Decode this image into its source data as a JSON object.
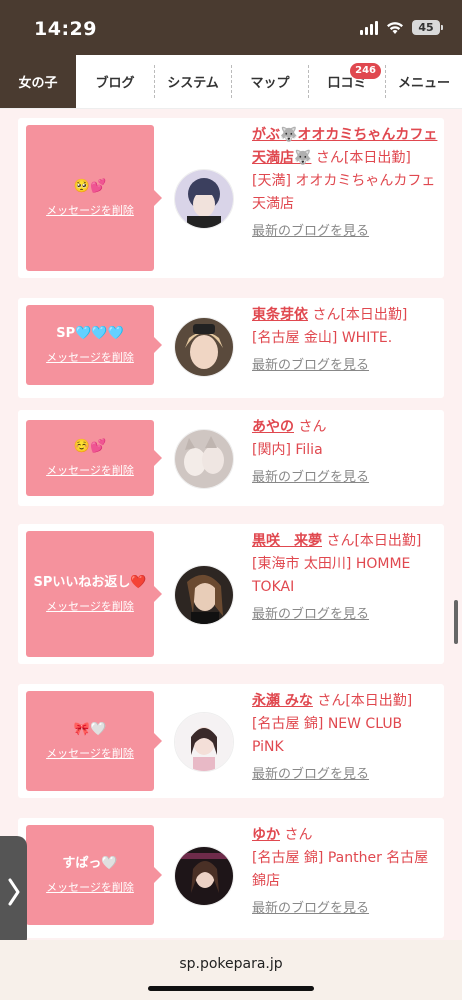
{
  "status_bar": {
    "time": "14:29",
    "battery": "45"
  },
  "nav": {
    "tabs": [
      {
        "label": "女の子"
      },
      {
        "label": "ブログ"
      },
      {
        "label": "システム"
      },
      {
        "label": "マップ"
      },
      {
        "label": "口コミ"
      },
      {
        "label": "メニュー"
      }
    ],
    "review_badge": "246"
  },
  "cards": [
    {
      "message": "🥺💕",
      "delete_label": "メッセージを削除",
      "name": "がぶ🐺オオカミちゃんカフェ天満店🐺",
      "san": "さん",
      "status": "[本日出勤]",
      "shop": "[天満] オオカミちゃんカフェ天満店",
      "blog_link": "最新のブログを見る"
    },
    {
      "message": "SP🩵🩵🩵",
      "delete_label": "メッセージを削除",
      "name": "東条芽依",
      "san": "さん",
      "status": "[本日出勤]",
      "shop": "[名古屋 金山] WHITE.",
      "blog_link": "最新のブログを見る"
    },
    {
      "message": "☺️💕",
      "delete_label": "メッセージを削除",
      "name": "あやの",
      "san": "さん",
      "status": "",
      "shop": "[関内] Filia",
      "blog_link": "最新のブログを見る"
    },
    {
      "message": "SPいいねお返し❤️",
      "delete_label": "メッセージを削除",
      "name": "黒咲　来夢",
      "san": "さん",
      "status": "[本日出勤]",
      "shop": "[東海市 太田川] HOMME TOKAI",
      "blog_link": "最新のブログを見る"
    },
    {
      "message": "🎀🤍",
      "delete_label": "メッセージを削除",
      "name": "永瀬 みな",
      "san": "さん",
      "status": "[本日出勤]",
      "shop": "[名古屋 錦] NEW CLUB PiNK",
      "blog_link": "最新のブログを見る"
    },
    {
      "message": "すぱっ🤍",
      "delete_label": "メッセージを削除",
      "name": "ゆか",
      "san": "さん",
      "status": "",
      "shop": "[名古屋 錦] Panther 名古屋錦店",
      "blog_link": "最新のブログを見る"
    }
  ],
  "side_tab_icon": "chevron-right",
  "url": "sp.pokepara.jp"
}
